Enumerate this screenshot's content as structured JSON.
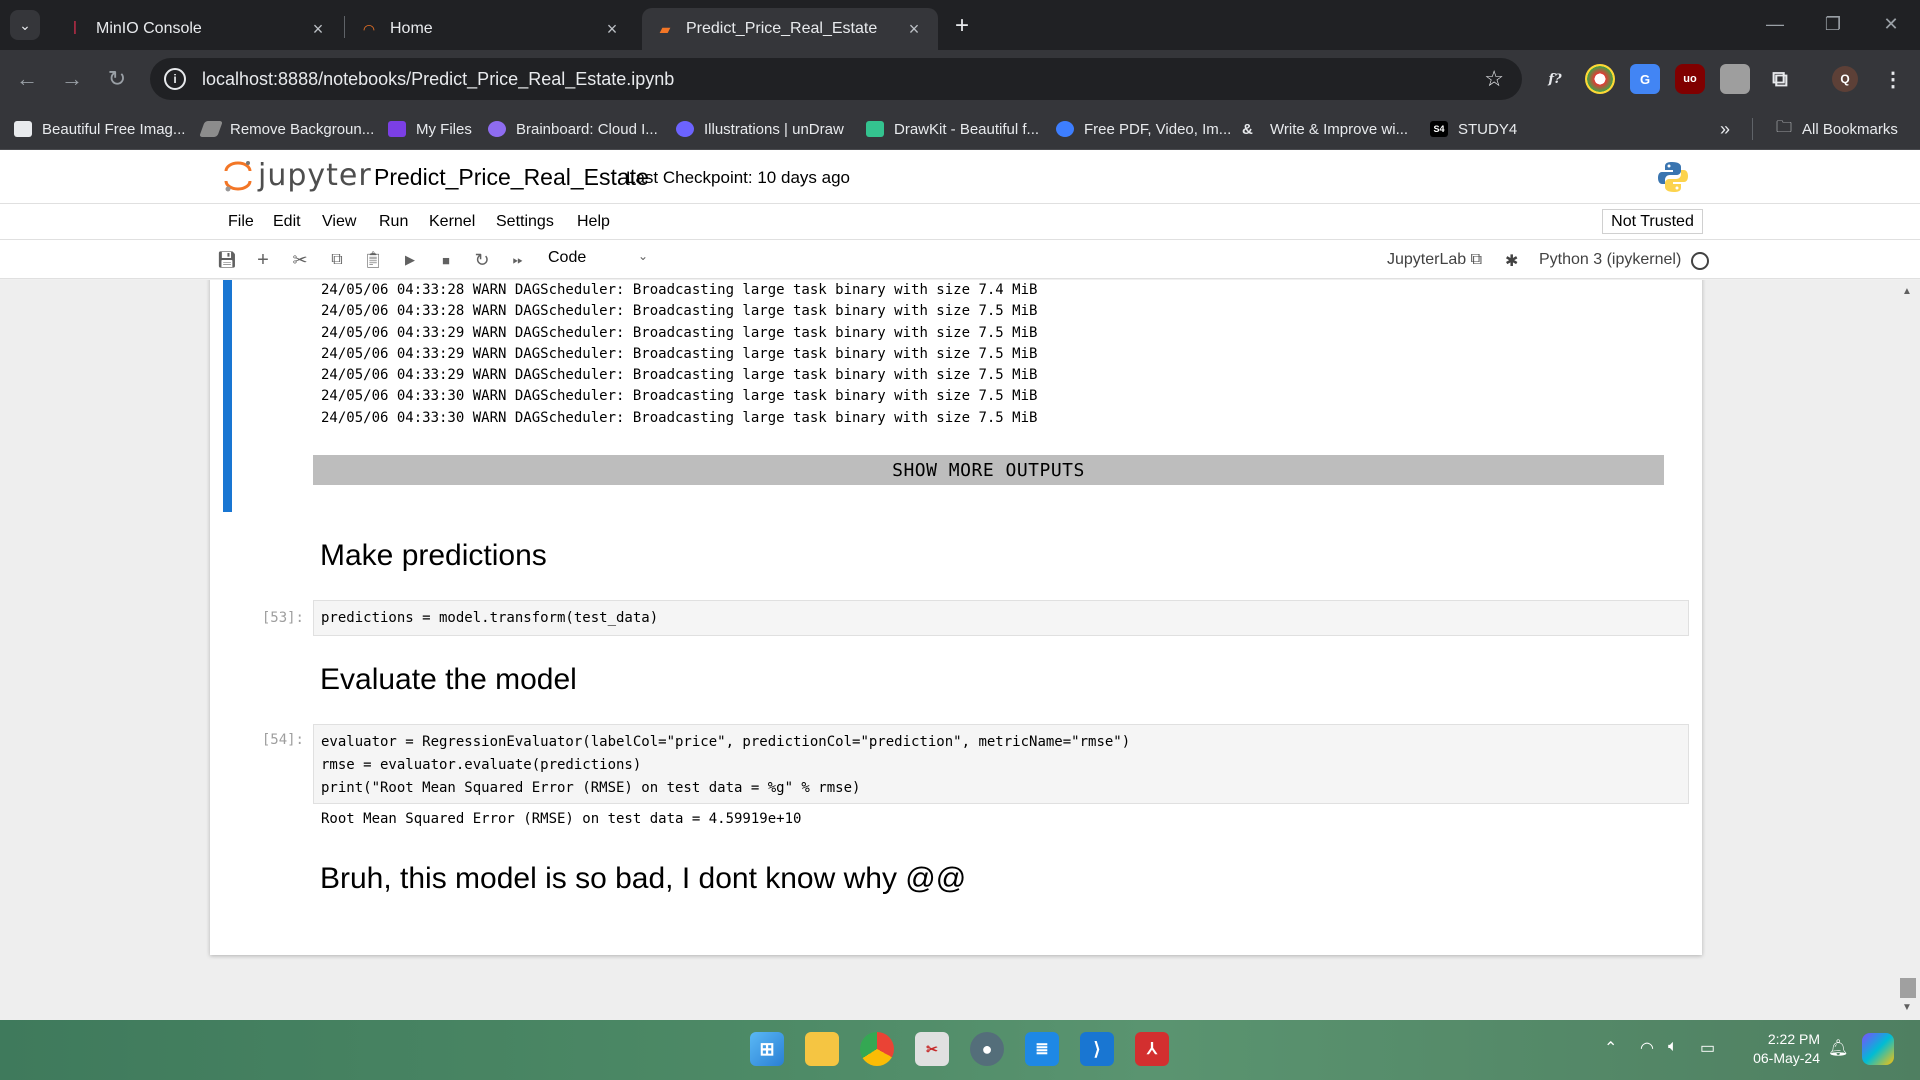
{
  "browser": {
    "tabs": [
      {
        "title": "MinIO Console",
        "active": false
      },
      {
        "title": "Home",
        "active": false
      },
      {
        "title": "Predict_Price_Real_Estate",
        "active": true
      }
    ],
    "new_tab": "+",
    "url": "localhost:8888/notebooks/Predict_Price_Real_Estate.ipynb",
    "profile_initial": "Q",
    "bookmarks": [
      "Beautiful Free Imag...",
      "Remove Backgroun...",
      "My Files",
      "Brainboard: Cloud I...",
      "Illustrations | unDraw",
      "DrawKit - Beautiful f...",
      "Free PDF, Video, Im...",
      "Write & Improve wi...",
      "STUDY4"
    ],
    "all_bookmarks": "All Bookmarks",
    "ext_labels": {
      "fx": "f?",
      "ublock": "uo",
      "study4": "S4"
    }
  },
  "jupyter": {
    "logo_text": "jupyter",
    "notebook_title": "Predict_Price_Real_Estate",
    "checkpoint": "Last Checkpoint: 10 days ago",
    "menu": [
      "File",
      "Edit",
      "View",
      "Run",
      "Kernel",
      "Settings",
      "Help"
    ],
    "trust_status": "Not Trusted",
    "cell_type": "Code",
    "jupyterlab_link": "JupyterLab",
    "kernel_name": "Python 3 (ipykernel)"
  },
  "notebook": {
    "stream_output": [
      "24/05/06 04:33:28 WARN DAGScheduler: Broadcasting large task binary with size 7.4 MiB",
      "24/05/06 04:33:28 WARN DAGScheduler: Broadcasting large task binary with size 7.5 MiB",
      "24/05/06 04:33:29 WARN DAGScheduler: Broadcasting large task binary with size 7.5 MiB",
      "24/05/06 04:33:29 WARN DAGScheduler: Broadcasting large task binary with size 7.5 MiB",
      "24/05/06 04:33:29 WARN DAGScheduler: Broadcasting large task binary with size 7.5 MiB",
      "24/05/06 04:33:30 WARN DAGScheduler: Broadcasting large task binary with size 7.5 MiB",
      "24/05/06 04:33:30 WARN DAGScheduler: Broadcasting large task binary with size 7.5 MiB"
    ],
    "show_more": "SHOW MORE OUTPUTS",
    "heading_1": "Make predictions",
    "cell_53": {
      "prompt": "[53]:",
      "code": "predictions = model.transform(test_data)"
    },
    "heading_2": "Evaluate the model",
    "cell_54": {
      "prompt": "[54]:",
      "lines": [
        "evaluator = RegressionEvaluator(labelCol=\"price\", predictionCol=\"prediction\", metricName=\"rmse\")",
        "rmse = evaluator.evaluate(predictions)",
        "print(\"Root Mean Squared Error (RMSE) on test data = %g\" % rmse)"
      ],
      "output": "Root Mean Squared Error (RMSE) on test data = 4.59919e+10"
    },
    "heading_3": "Bruh, this model is so bad, I dont know why @@"
  },
  "taskbar": {
    "time": "2:22 PM",
    "date": "06-May-24"
  },
  "colors": {
    "active_cell": "#1976d2",
    "chrome_dark": "#202124",
    "chrome_mid": "#35363a"
  }
}
